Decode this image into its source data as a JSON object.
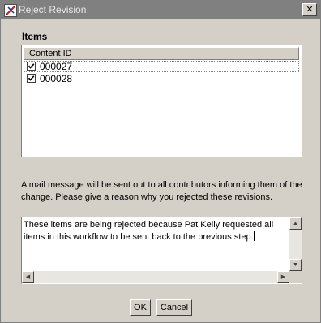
{
  "window": {
    "title": "Reject Revision"
  },
  "items": {
    "label": "Items",
    "column_header": "Content ID",
    "rows": [
      {
        "id": "000027",
        "checked": true
      },
      {
        "id": "000028",
        "checked": true
      }
    ]
  },
  "info": {
    "line1": "A mail message will be sent out to all contributors informing them of the",
    "line2": "change. Please give a reason why you rejected these revisions."
  },
  "reason": {
    "line1": "These items are being rejected because Pat Kelly requested all",
    "line2": "items in this workflow to be sent back to the previous step."
  },
  "buttons": {
    "ok": "OK",
    "cancel": "Cancel"
  },
  "icons": {
    "title": "app-icon",
    "close": "close-icon",
    "check": "checkmark-icon",
    "scroll_up": "arrow-up-icon",
    "scroll_down": "arrow-down-icon",
    "scroll_left": "arrow-left-icon",
    "scroll_right": "arrow-right-icon"
  }
}
